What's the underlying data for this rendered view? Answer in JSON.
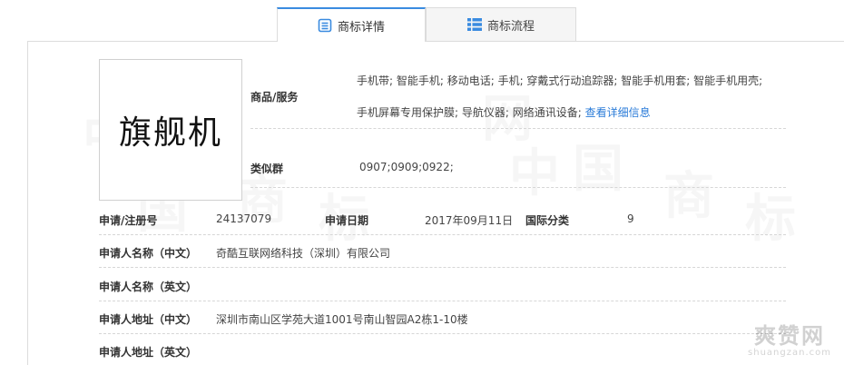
{
  "tabs": [
    {
      "label": "商标详情",
      "icon": "document-list-icon",
      "active": true
    },
    {
      "label": "商标流程",
      "icon": "list-icon",
      "active": false
    }
  ],
  "trademark": {
    "name": "旗舰机",
    "goods_services_label": "商品/服务",
    "goods_services_line1": "手机带; 智能手机; 移动电话; 手机; 穿戴式行动追踪器; 智能手机用套; 智能手机用壳;",
    "goods_services_line2": "手机屏幕专用保护膜; 导航仪器; 网络通讯设备;",
    "details_link": "查看详细信息",
    "similar_group_label": "类似群",
    "similar_group": "0907;0909;0922;"
  },
  "info": {
    "reg_no_label": "申请/注册号",
    "reg_no": "24137079",
    "apply_date_label": "申请日期",
    "apply_date": "2017年09月11日",
    "intl_class_label": "国际分类",
    "intl_class": "9",
    "applicant_cn_label": "申请人名称（中文）",
    "applicant_cn": "奇酷互联网络科技（深圳）有限公司",
    "applicant_en_label": "申请人名称（英文）",
    "applicant_en": "",
    "address_cn_label": "申请人地址（中文）",
    "address_cn": "深圳市南山区学苑大道1001号南山智园A2栋1-10楼",
    "address_en_label": "申请人地址（英文）",
    "address_en": ""
  },
  "watermark": {
    "chars": [
      "中",
      "国",
      "商",
      "标",
      "网",
      "中",
      "国",
      "商",
      "标"
    ],
    "site_logo": "爽赞网",
    "site_url": "shuangzan.com"
  }
}
